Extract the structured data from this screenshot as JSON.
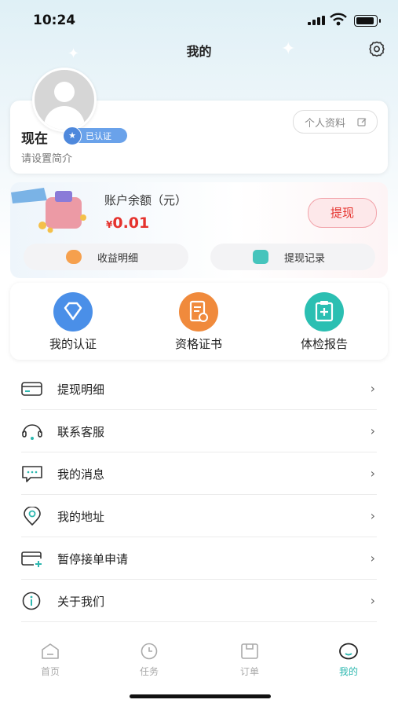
{
  "status_bar": {
    "time": "10:24"
  },
  "header": {
    "title": "我的"
  },
  "profile": {
    "name": "现在",
    "verified_badge": "已认证",
    "bio": "请设置简介",
    "edit_button": "个人资料"
  },
  "balance": {
    "label": "账户余额（元）",
    "currency": "¥",
    "amount": "0.01",
    "withdraw_button": "提现",
    "income_detail": "收益明细",
    "withdraw_records": "提现记录"
  },
  "quick_actions": [
    {
      "label": "我的认证",
      "icon": "diamond-icon",
      "color": "#4a8fe8"
    },
    {
      "label": "资格证书",
      "icon": "certificate-icon",
      "color": "#f08a3c"
    },
    {
      "label": "体检报告",
      "icon": "medical-report-icon",
      "color": "#2bbfb2"
    }
  ],
  "menu": [
    {
      "label": "提现明细",
      "icon": "card-icon"
    },
    {
      "label": "联系客服",
      "icon": "headset-icon"
    },
    {
      "label": "我的消息",
      "icon": "message-icon"
    },
    {
      "label": "我的地址",
      "icon": "location-icon"
    },
    {
      "label": "暂停接单申请",
      "icon": "pause-card-icon"
    },
    {
      "label": "关于我们",
      "icon": "info-icon"
    }
  ],
  "tabs": [
    {
      "label": "首页",
      "icon": "home-icon"
    },
    {
      "label": "任务",
      "icon": "clock-icon"
    },
    {
      "label": "订单",
      "icon": "order-icon"
    },
    {
      "label": "我的",
      "icon": "profile-icon",
      "active": true
    }
  ],
  "colors": {
    "accent": "#2eb8b0",
    "money": "#e5322d",
    "badge": "#6aa2ea"
  }
}
